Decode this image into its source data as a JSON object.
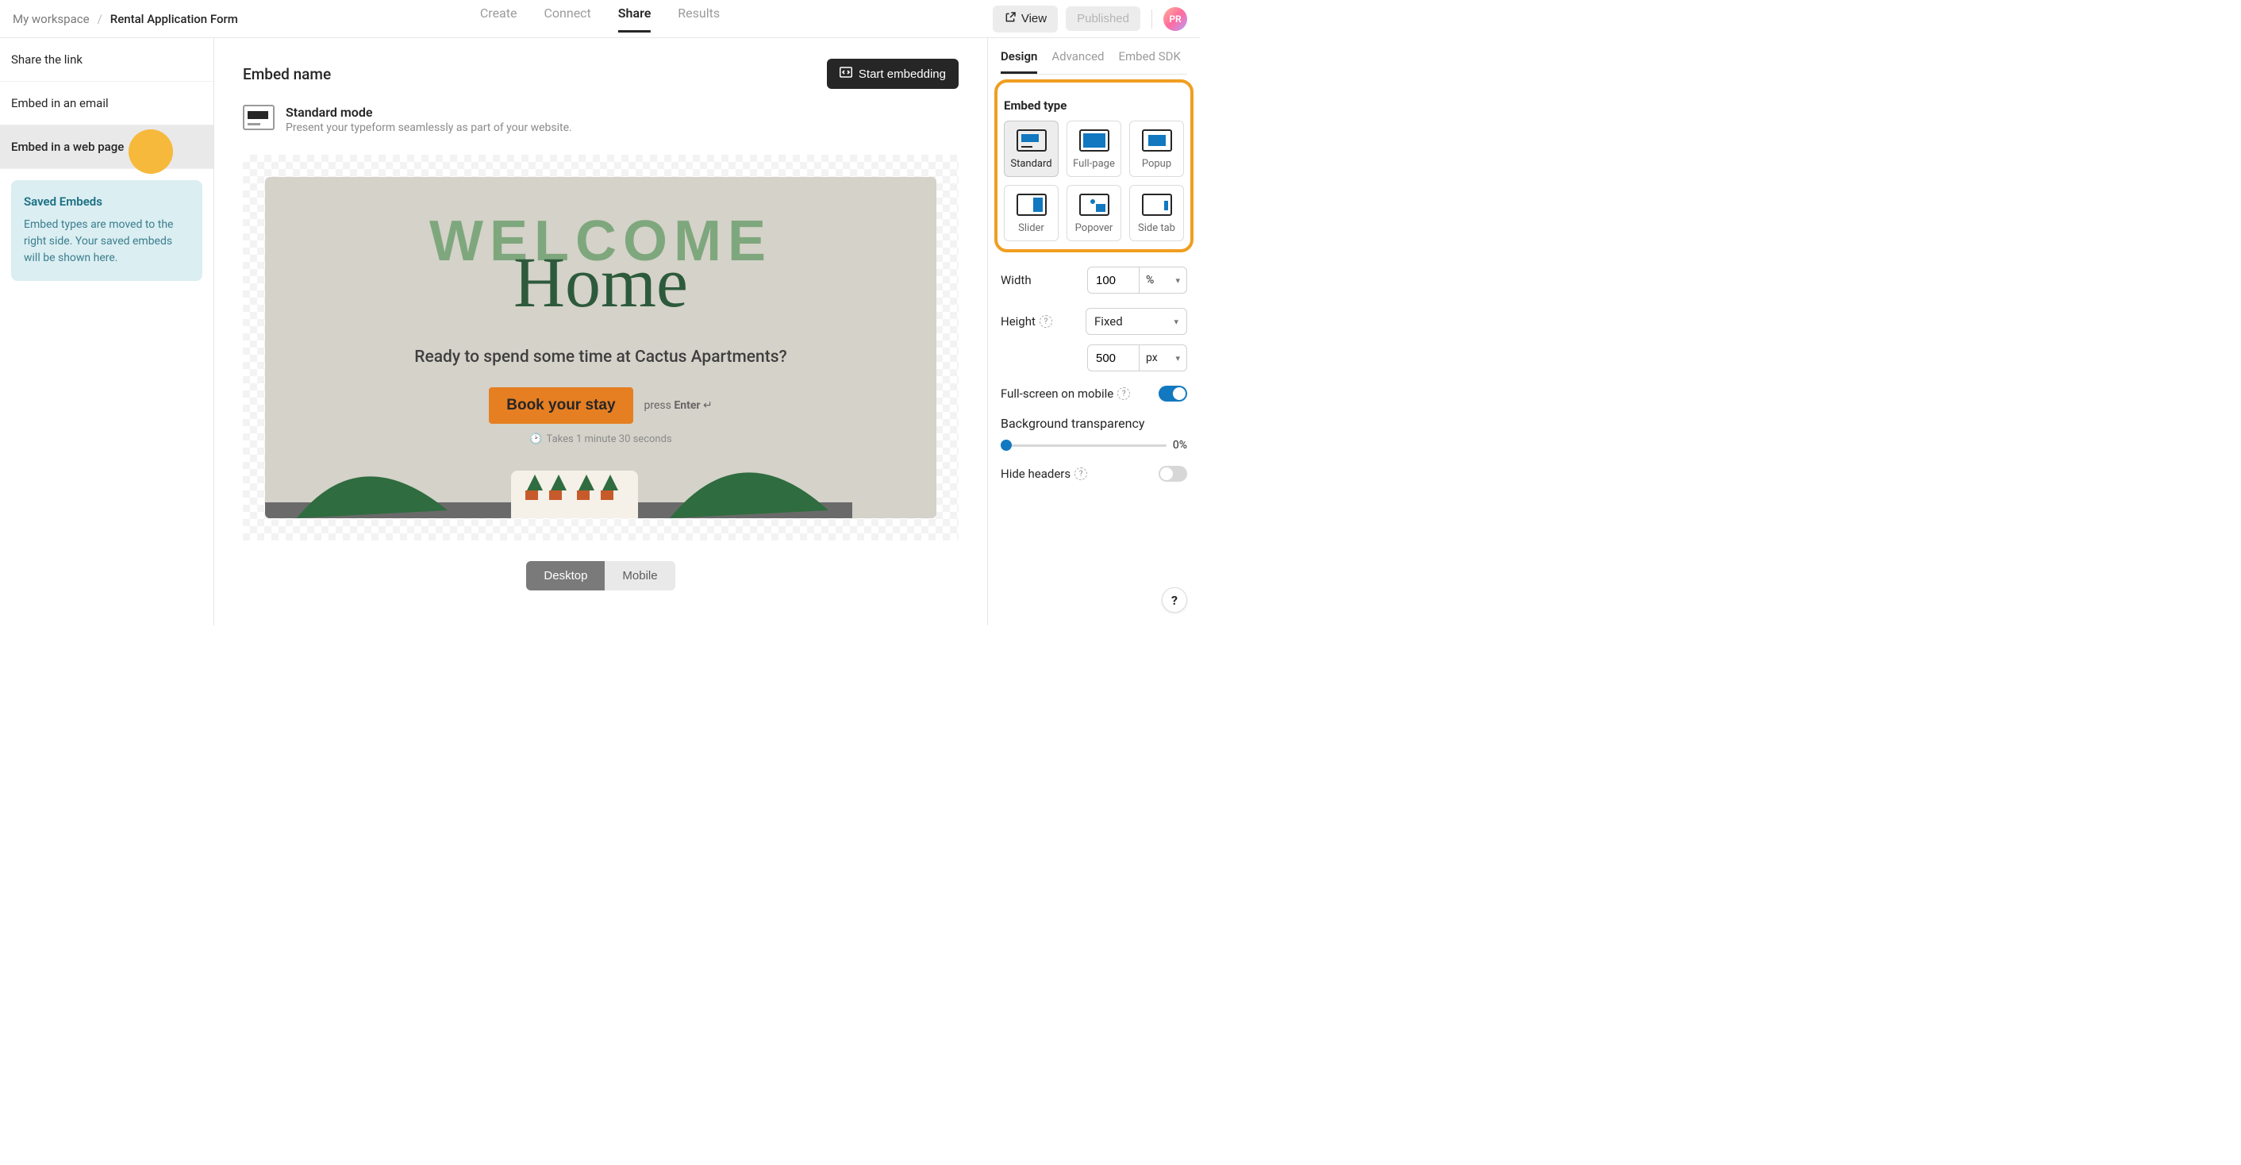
{
  "header": {
    "workspace": "My workspace",
    "separator": "/",
    "form_title": "Rental Application Form",
    "nav": {
      "create": "Create",
      "connect": "Connect",
      "share": "Share",
      "results": "Results"
    },
    "view_btn": "View",
    "published_btn": "Published",
    "avatar": "PR"
  },
  "sidebar": {
    "items": [
      {
        "label": "Share the link"
      },
      {
        "label": "Embed in an email"
      },
      {
        "label": "Embed in a web page"
      }
    ],
    "info": {
      "title": "Saved Embeds",
      "body": "Embed types are moved to the right side. Your saved embeds will be shown here."
    }
  },
  "center": {
    "embed_name_label": "Embed name",
    "start_embedding": "Start embedding",
    "mode_title": "Standard mode",
    "mode_desc": "Present your typeform seamlessly as part of your website.",
    "preview": {
      "welcome": "WELCOME",
      "home": "Home",
      "sub": "Ready to spend some time at Cactus Apartments?",
      "cta": "Book your stay",
      "press": "press",
      "enter": "Enter",
      "arrow": "↵",
      "takes": "Takes 1 minute 30 seconds"
    },
    "toggle": {
      "desktop": "Desktop",
      "mobile": "Mobile"
    }
  },
  "right": {
    "tabs": {
      "design": "Design",
      "advanced": "Advanced",
      "sdk": "Embed SDK"
    },
    "embed_type_label": "Embed type",
    "types": {
      "standard": "Standard",
      "fullpage": "Full-page",
      "popup": "Popup",
      "slider": "Slider",
      "popover": "Popover",
      "sidetab": "Side tab"
    },
    "width": {
      "label": "Width",
      "value": "100",
      "unit": "%"
    },
    "height": {
      "label": "Height",
      "mode": "Fixed",
      "value": "500",
      "unit": "px"
    },
    "fullscreen_mobile": "Full-screen on mobile",
    "bg_transparency": {
      "label": "Background transparency",
      "value": "0%"
    },
    "hide_headers": "Hide headers",
    "help_q": "?"
  }
}
